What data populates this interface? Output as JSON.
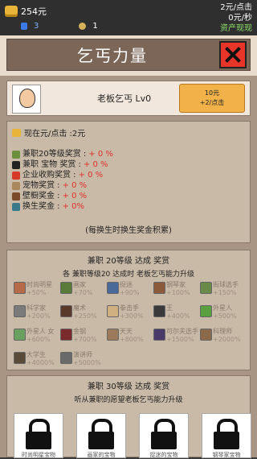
{
  "top": {
    "money": "254元",
    "gems": "3",
    "bags": "1",
    "per_click": "2元/点击",
    "per_sec": "0元/秒",
    "cash_out": "资产现现"
  },
  "title": "乞丐力量",
  "boss": {
    "name": "老板乞丐 Lv0",
    "price": "10元",
    "gain": "+2/点击"
  },
  "income": {
    "header": "现在元/点击 :2元",
    "rows": [
      {
        "label": "兼职20等级奖赏 :",
        "value": "+ 0 %",
        "icon_color": "#6b8f3a"
      },
      {
        "label": "兼职 宝物 奖赏 :",
        "value": "+ 0 %",
        "icon_color": "#222222"
      },
      {
        "label": "企业收购奖赏 :",
        "value": "+ 0 %",
        "icon_color": "#d83a2a"
      },
      {
        "label": "宠物奖赏 :",
        "value": "+ 0 %",
        "icon_color": "#a9875f"
      },
      {
        "label": "壁橱奖金 :",
        "value": "+ 0 %",
        "icon_color": "#7a4a2a"
      },
      {
        "label": "换生奖金 :",
        "value": "+ 0%",
        "icon_color": "#3a7a8a"
      }
    ],
    "note": "(每换生时换生奖金积累)"
  },
  "ach1": {
    "title": "兼职 20等级 达成 奖赏",
    "subtitle": "各 兼职等级20 达成时 老板乞丐能力升级",
    "items": [
      {
        "name": "时尚明星",
        "pct": "+50%",
        "color": "#b66a4a"
      },
      {
        "name": "画家",
        "pct": "+70%",
        "color": "#5a7a3a"
      },
      {
        "name": "捉迷",
        "pct": "+90%",
        "color": "#4a6a9a"
      },
      {
        "name": "钢琴家",
        "pct": "+100%",
        "color": "#8a5a3a"
      },
      {
        "name": "街球选手",
        "pct": "+150%",
        "color": "#6a8a4a"
      },
      {
        "name": "科学家",
        "pct": "+200%",
        "color": "#7a7a7a"
      },
      {
        "name": "魔术",
        "pct": "+250%",
        "color": "#5a3a2a"
      },
      {
        "name": "拳击手",
        "pct": "+300%",
        "color": "#d0b080"
      },
      {
        "name": "王",
        "pct": "+400%",
        "color": "#3a3a3a"
      },
      {
        "name": "外星人",
        "pct": "+500%",
        "color": "#5aa040"
      },
      {
        "name": "外星人 女",
        "pct": "+600%",
        "color": "#6aa060"
      },
      {
        "name": "金钢",
        "pct": "+700%",
        "color": "#7a2a2a"
      },
      {
        "name": "天天",
        "pct": "+800%",
        "color": "#9a7a5a"
      },
      {
        "name": "可尔夫选手",
        "pct": "+1500%",
        "color": "#4a3a6a"
      },
      {
        "name": "科理师",
        "pct": "+2000%",
        "color": "#8a6a4a"
      },
      {
        "name": "大学生",
        "pct": "+4000%",
        "color": "#5a4a3a"
      },
      {
        "name": "演讲师",
        "pct": "+5000%",
        "color": "#6a6a6a"
      }
    ]
  },
  "ach2": {
    "title": "兼职 30等级 达成 奖赏",
    "subtitle": "听从兼职的愿望老板乞丐能力升级",
    "locks": [
      "时尚明星宝物",
      "画家的宝物",
      "捉迷的宝物",
      "钢琴家宝物"
    ]
  }
}
